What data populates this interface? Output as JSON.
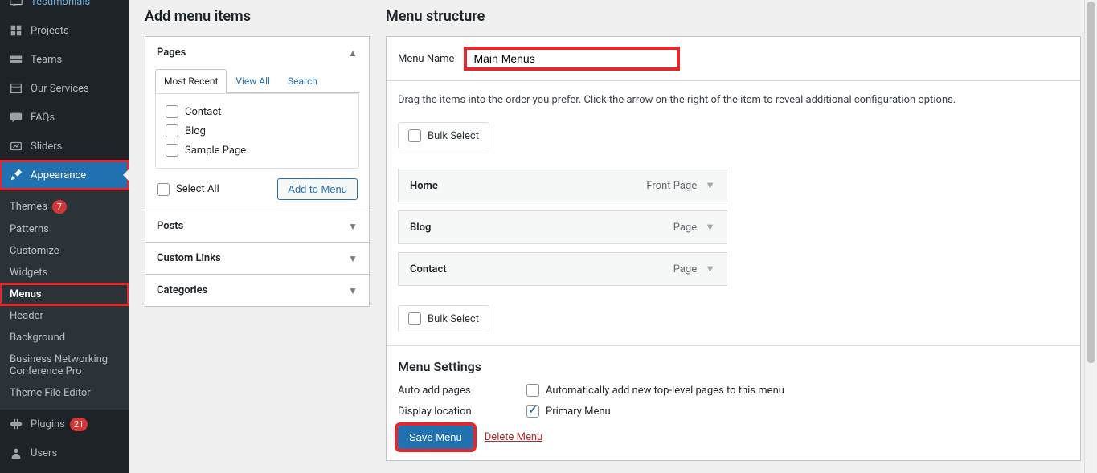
{
  "sidebar": {
    "items": [
      {
        "label": "Testimonials"
      },
      {
        "label": "Projects"
      },
      {
        "label": "Teams"
      },
      {
        "label": "Our Services"
      },
      {
        "label": "FAQs"
      },
      {
        "label": "Sliders"
      },
      {
        "label": "Appearance"
      },
      {
        "label": "Plugins"
      },
      {
        "label": "Users"
      }
    ],
    "plugins_badge": "21",
    "submenu": {
      "themes": {
        "label": "Themes",
        "badge": "7"
      },
      "patterns": "Patterns",
      "customize": "Customize",
      "widgets": "Widgets",
      "menus": "Menus",
      "header": "Header",
      "background": "Background",
      "bn": "Business Networking Conference Pro",
      "tfe": "Theme File Editor"
    }
  },
  "addMenu": {
    "heading": "Add menu items",
    "pages": {
      "title": "Pages",
      "tabs": {
        "recent": "Most Recent",
        "all": "View All",
        "search": "Search"
      },
      "items": [
        "Contact",
        "Blog",
        "Sample Page"
      ],
      "selectAll": "Select All",
      "addBtn": "Add to Menu"
    },
    "posts": "Posts",
    "customLinks": "Custom Links",
    "categories": "Categories"
  },
  "structure": {
    "heading": "Menu structure",
    "menuNameLabel": "Menu Name",
    "menuNameValue": "Main Menus",
    "hint": "Drag the items into the order you prefer. Click the arrow on the right of the item to reveal additional configuration options.",
    "bulkSelect": "Bulk Select",
    "items": [
      {
        "label": "Home",
        "type": "Front Page"
      },
      {
        "label": "Blog",
        "type": "Page"
      },
      {
        "label": "Contact",
        "type": "Page"
      }
    ]
  },
  "settings": {
    "heading": "Menu Settings",
    "autoAddLabel": "Auto add pages",
    "autoAddOption": "Automatically add new top-level pages to this menu",
    "displayLabel": "Display location",
    "displayOption": "Primary Menu",
    "saveBtn": "Save Menu",
    "deleteLink": "Delete Menu"
  }
}
